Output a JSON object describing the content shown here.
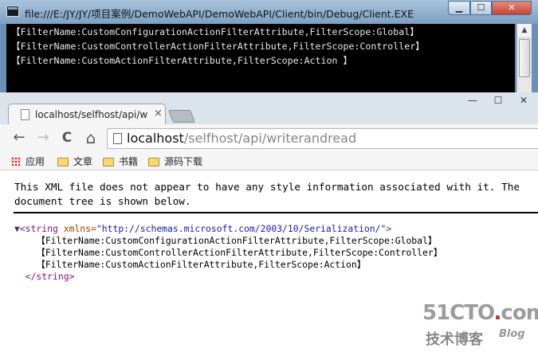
{
  "console": {
    "title": "file:///E:/JY/JY/项目案例/DemoWebAPI/DemoWebAPI/Client/bin/Debug/Client.EXE",
    "buttons": {
      "minimize": "▁",
      "maximize": "☐",
      "close": "✕"
    },
    "lines": [
      "【FilterName:CustomConfigurationActionFilterAttribute,FilterScope:Global】",
      "【FilterName:CustomControllerActionFilterAttribute,FilterScope:Controller】",
      "【FilterName:CustomActionFilterAttribute,FilterScope:Action 】"
    ]
  },
  "browser": {
    "tab": {
      "title": "localhost/selfhost/api/w",
      "close": "×"
    },
    "window_controls": {
      "minimize": "—",
      "maximize": "☐",
      "close": "✕"
    },
    "nav": {
      "back": "←",
      "forward": "→",
      "reload": "C",
      "home": "⌂"
    },
    "address": {
      "host": "localhost",
      "path": "/selfhost/api/writerandread"
    },
    "bookmarks": [
      {
        "label": "应用",
        "icon": "apps-icon"
      },
      {
        "label": "文章",
        "icon": "folder-icon"
      },
      {
        "label": "书籍",
        "icon": "folder-icon"
      },
      {
        "label": "源码下载",
        "icon": "folder-icon"
      }
    ],
    "content": {
      "warning_line1": "This XML file does not appear to have any style information associated with it. The",
      "warning_line2": "document tree is shown below.",
      "xml": {
        "toggle": "▼",
        "open_tag": "<string",
        "attr_name": " xmlns=",
        "attr_value": "\"http://schemas.microsoft.com/2003/10/Serialization/\"",
        "open_close": ">",
        "lines": [
          "【FilterName:CustomConfigurationActionFilterAttribute,FilterScope:Global】",
          "【FilterName:CustomControllerActionFilterAttribute,FilterScope:Controller】",
          "【FilterName:CustomActionFilterAttribute,FilterScope:Action】"
        ],
        "close_tag": "</string>"
      }
    }
  },
  "watermark": {
    "brand": "51CTO",
    "dot": ".",
    "suffix": "com",
    "tagline": "技术博客",
    "blog": "Blog"
  }
}
